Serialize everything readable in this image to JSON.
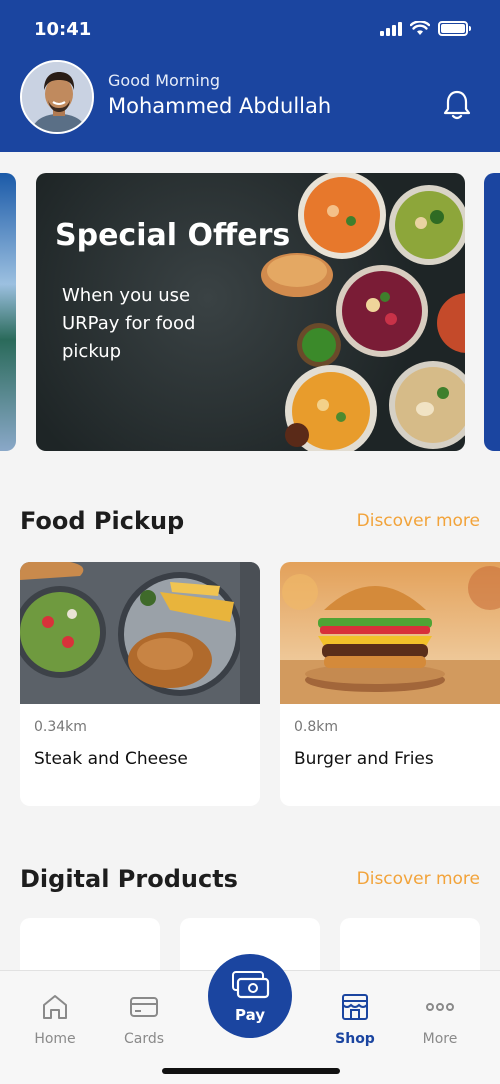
{
  "status_bar": {
    "time": "10:41"
  },
  "header": {
    "greeting": "Good Morning",
    "user_name": "Mohammed Abdullah"
  },
  "banner": {
    "title": "Special Offers",
    "subtitle": "When you use URPay for food pickup"
  },
  "food_pickup": {
    "title": "Food Pickup",
    "discover_label": "Discover more",
    "items": [
      {
        "distance": "0.34km",
        "name": "Steak and Cheese"
      },
      {
        "distance": "0.8km",
        "name": "Burger and Fries"
      }
    ]
  },
  "digital_products": {
    "title": "Digital Products",
    "discover_label": "Discover more"
  },
  "tabbar": {
    "home": "Home",
    "cards": "Cards",
    "pay": "Pay",
    "shop": "Shop",
    "more": "More",
    "active": "shop"
  },
  "colors": {
    "brand_blue": "#1b45a0",
    "accent_orange": "#f2a33a",
    "background": "#f4f4f4"
  }
}
